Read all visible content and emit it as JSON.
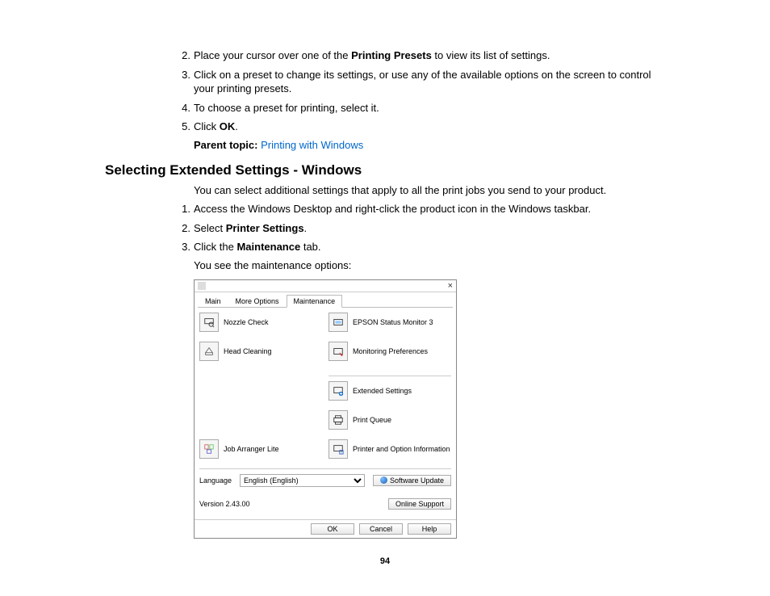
{
  "steps_a": [
    {
      "n": "2.",
      "pre": "Place your cursor over one of the ",
      "bold": "Printing Presets",
      "post": " to view its list of settings."
    },
    {
      "n": "3.",
      "pre": "Click on a preset to change its settings, or use any of the available options on the screen to control your printing presets.",
      "bold": "",
      "post": ""
    },
    {
      "n": "4.",
      "pre": "To choose a preset for printing, select it.",
      "bold": "",
      "post": ""
    },
    {
      "n": "5.",
      "pre": "Click ",
      "bold": "OK",
      "post": "."
    }
  ],
  "parent_topic": {
    "label": "Parent topic: ",
    "link": "Printing with Windows"
  },
  "section_title": "Selecting Extended Settings - Windows",
  "intro": "You can select additional settings that apply to all the print jobs you send to your product.",
  "steps_b": [
    {
      "n": "1.",
      "pre": "Access the Windows Desktop and right-click the product icon in the Windows taskbar.",
      "bold": "",
      "post": ""
    },
    {
      "n": "2.",
      "pre": "Select ",
      "bold": "Printer Settings",
      "post": "."
    },
    {
      "n": "3.",
      "pre": "Click the ",
      "bold": "Maintenance",
      "post": " tab."
    }
  ],
  "after_step": "You see the maintenance options:",
  "dialog": {
    "tabs": {
      "main": "Main",
      "more": "More Options",
      "maint": "Maintenance"
    },
    "left": {
      "nozzle": "Nozzle Check",
      "head": "Head Cleaning",
      "arranger": "Job Arranger Lite"
    },
    "right": {
      "status": "EPSON Status Monitor 3",
      "monpref": "Monitoring Preferences",
      "ext": "Extended Settings",
      "queue": "Print Queue",
      "info": "Printer and Option Information"
    },
    "lang_label": "Language",
    "lang_value": "English (English)",
    "update": "Software Update",
    "version": "Version 2.43.00",
    "support": "Online Support",
    "ok": "OK",
    "cancel": "Cancel",
    "help": "Help",
    "close": "×"
  },
  "page_number": "94"
}
